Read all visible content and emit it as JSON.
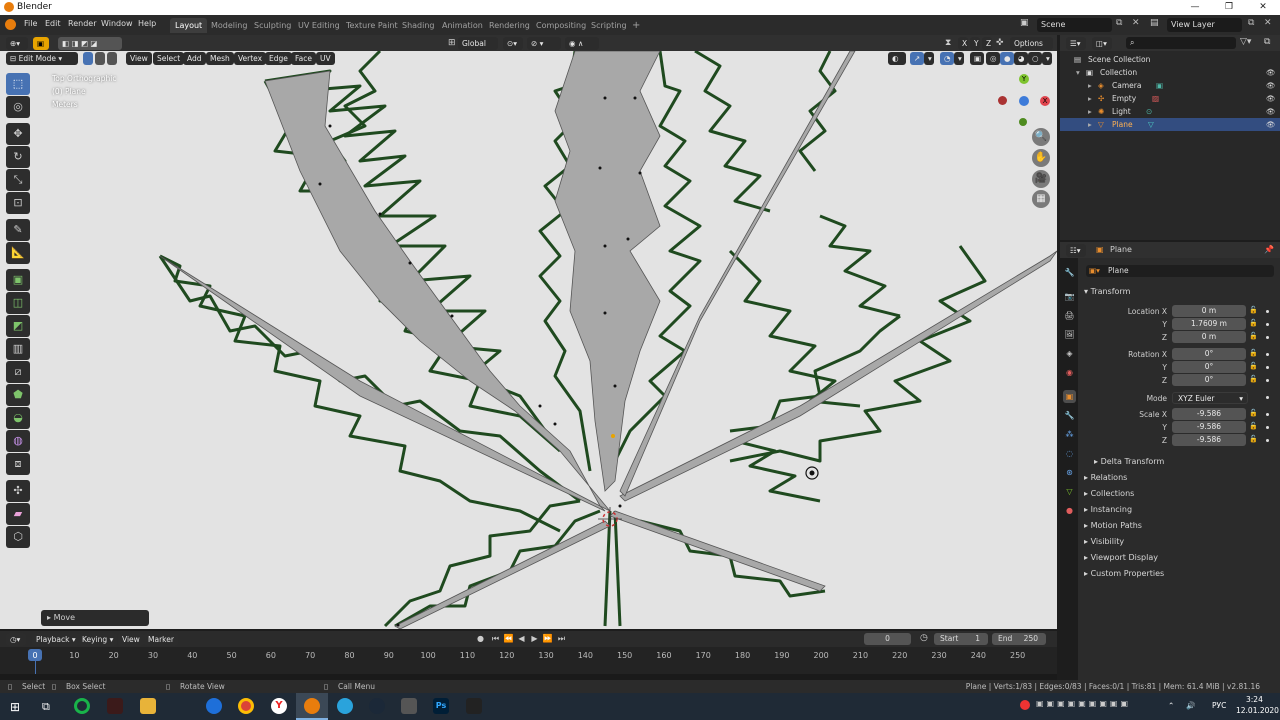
{
  "window": {
    "title": "Blender",
    "minimize": "—",
    "maximize": "❐",
    "close": "✕"
  },
  "menu": [
    "File",
    "Edit",
    "Render",
    "Window",
    "Help"
  ],
  "workspaces": [
    "Layout",
    "Modeling",
    "Sculpting",
    "UV Editing",
    "Texture Paint",
    "Shading",
    "Animation",
    "Rendering",
    "Compositing",
    "Scripting"
  ],
  "scene": "Scene",
  "view_layer": "View Layer",
  "viewport_header": {
    "mode": "Edit Mode",
    "view": "View",
    "select": "Select",
    "add": "Add",
    "mesh": "Mesh",
    "vertex": "Vertex",
    "edge": "Edge",
    "face": "Face",
    "uv": "UV",
    "transform_orientation": "Global",
    "options": "Options",
    "axes": [
      "X",
      "Y",
      "Z"
    ]
  },
  "viewport_info": {
    "line1": "Top Orthographic",
    "line2": "(0) Plane",
    "line3": "Meters"
  },
  "last_operator": "Move",
  "timeline": {
    "playback": "Playback",
    "keying": "Keying",
    "view": "View",
    "marker": "Marker",
    "current_frame": "0",
    "start_label": "Start",
    "start": "1",
    "end_label": "End",
    "end": "250",
    "ticks": [
      "0",
      "10",
      "20",
      "30",
      "40",
      "50",
      "60",
      "70",
      "80",
      "90",
      "100",
      "110",
      "120",
      "130",
      "140",
      "150",
      "160",
      "170",
      "180",
      "190",
      "200",
      "210",
      "220",
      "230",
      "240",
      "250"
    ]
  },
  "statusbar": {
    "select": "Select",
    "box_select": "Box Select",
    "rotate_view": "Rotate View",
    "call_menu": "Call Menu",
    "stats": "Plane | Verts:1/83 | Edges:0/83 | Faces:0/1 | Tris:81 | Mem: 61.4 MiB | v2.81.16"
  },
  "outliner": {
    "rows": [
      {
        "label": "Scene Collection"
      },
      {
        "label": "Collection"
      },
      {
        "label": "Camera"
      },
      {
        "label": "Empty"
      },
      {
        "label": "Light"
      },
      {
        "label": "Plane"
      }
    ]
  },
  "properties": {
    "object_name_header": "Plane",
    "object_name": "Plane",
    "transform_label": "Transform",
    "location": {
      "label": "Location X",
      "x": "0 m",
      "y": "1.7609 m",
      "z": "0 m"
    },
    "rotation": {
      "label": "Rotation X",
      "x": "0°",
      "y": "0°",
      "z": "0°"
    },
    "mode_label": "Mode",
    "mode": "XYZ Euler",
    "scale": {
      "label": "Scale X",
      "x": "-9.586",
      "y": "-9.586",
      "z": "-9.586"
    },
    "y_label": "Y",
    "z_label": "Z",
    "sections": [
      "Delta Transform",
      "Relations",
      "Collections",
      "Instancing",
      "Motion Paths",
      "Visibility",
      "Viewport Display",
      "Custom Properties"
    ]
  },
  "tray": {
    "lang": "РУС",
    "time": "3:24",
    "date": "12.01.2020"
  },
  "colors": {
    "accent": "#4772b3",
    "selected_row": "#334d80",
    "leaf_outline": "#1f4a1f",
    "mesh_fill": "#a8a8a8"
  }
}
